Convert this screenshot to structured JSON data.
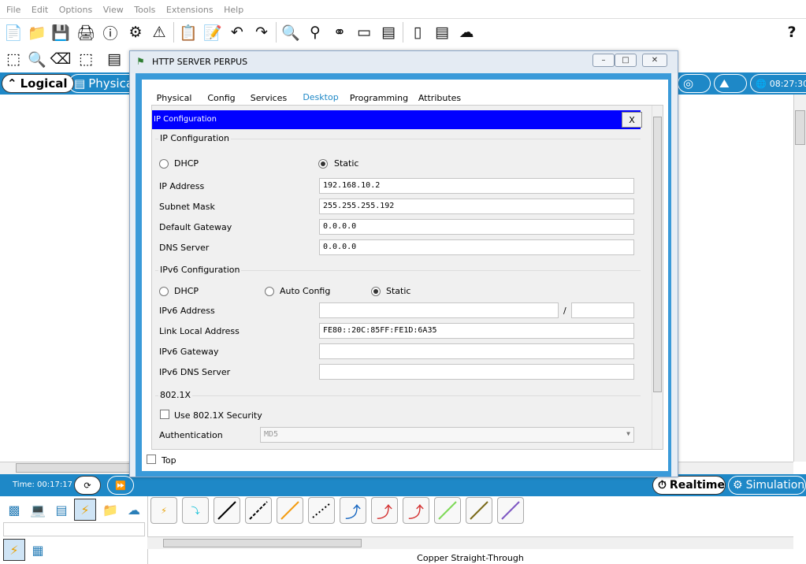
{
  "menu": [
    "File",
    "Edit",
    "Options",
    "View",
    "Tools",
    "Extensions",
    "Help"
  ],
  "toolbar": {
    "icons": [
      "new-file-icon",
      "open-folder-icon",
      "save-icon",
      "print-icon",
      "info-icon",
      "network-wizard-icon",
      "activity-wizard-icon",
      "copy-icon",
      "paste-icon",
      "undo-icon",
      "redo-icon",
      "zoom-in-icon",
      "zoom-reset-icon",
      "zoom-out-icon",
      "drawing-palette-icon",
      "custom-devices-icon",
      "tablet-icon",
      "server-icon",
      "cloud-icon"
    ],
    "help": "?"
  },
  "tabs": {
    "logical": "Logical",
    "physical": "Physica"
  },
  "top_time": "08:27:30",
  "status": {
    "time_label": "Time: 00:17:17",
    "realtime": "Realtime",
    "simulation": "Simulation"
  },
  "bottom": {
    "cable_label": "Copper Straight-Through"
  },
  "dialog": {
    "title": "HTTP SERVER PERPUS",
    "tabs": [
      "Physical",
      "Config",
      "Services",
      "Desktop",
      "Programming",
      "Attributes"
    ],
    "active_tab": "Desktop",
    "header": "IP Configuration",
    "close": "X",
    "ipv4": {
      "group": "IP Configuration",
      "dhcp": "DHCP",
      "static": "Static",
      "ip_label": "IP Address",
      "ip_value": "192.168.10.2",
      "mask_label": "Subnet Mask",
      "mask_value": "255.255.255.192",
      "gw_label": "Default Gateway",
      "gw_value": "0.0.0.0",
      "dns_label": "DNS Server",
      "dns_value": "0.0.0.0"
    },
    "ipv6": {
      "group": "IPv6 Configuration",
      "dhcp": "DHCP",
      "auto": "Auto Config",
      "static": "Static",
      "addr_label": "IPv6 Address",
      "slash": "/",
      "link_label": "Link Local Address",
      "link_value": "FE80::20C:85FF:FE1D:6A35",
      "gw_label": "IPv6 Gateway",
      "dns_label": "IPv6 DNS Server"
    },
    "dot1x": {
      "group": "802.1X",
      "use": "Use 802.1X Security",
      "auth_label": "Authentication",
      "auth_value": "MD5"
    },
    "top_checkbox": "Top"
  },
  "colors": {
    "accent": "#1e88c7",
    "header_blue": "#0000ff"
  }
}
